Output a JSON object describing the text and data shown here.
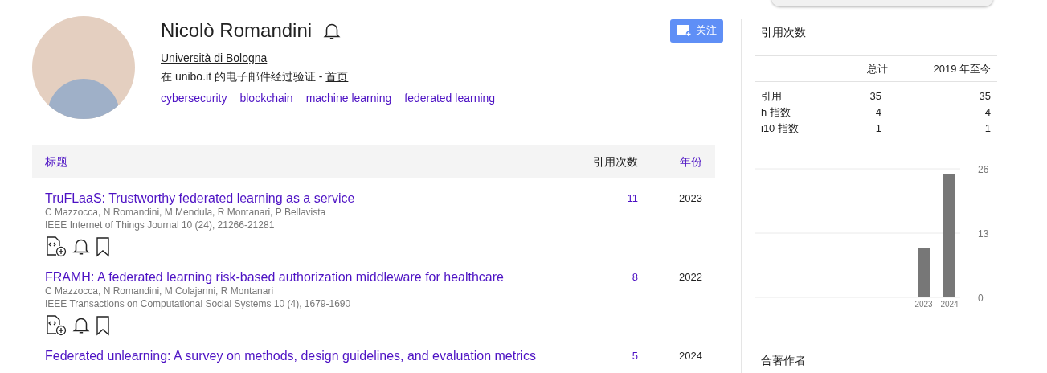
{
  "profile": {
    "name": "Nicolò Romandini",
    "affiliation": "Università di Bologna",
    "email_prefix": "在 unibo.it 的电子邮件经过验证 - ",
    "homepage": "首页",
    "interests": [
      "cybersecurity",
      "blockchain",
      "machine learning",
      "federated learning"
    ],
    "follow_button": "关注"
  },
  "articles": {
    "columns": [
      "标题",
      "引用次数",
      "年份"
    ],
    "rows": [
      {
        "title": "TruFLaaS: Trustworthy federated learning as a service",
        "authors": "C Mazzocca, N Romandini, M Mendula, R Montanari, P Bellavista",
        "venue": "IEEE Internet of Things Journal 10 (24), 21266-21281",
        "cited": "11",
        "year": "2023",
        "show_actions": true
      },
      {
        "title": "FRAMH: A federated learning risk-based authorization middleware for healthcare",
        "authors": "C Mazzocca, N Romandini, M Colajanni, R Montanari",
        "venue": "IEEE Transactions on Computational Social Systems 10 (4), 1679-1690",
        "cited": "8",
        "year": "2022",
        "show_actions": true
      },
      {
        "title": "Federated unlearning: A survey on methods, design guidelines, and evaluation metrics",
        "cited": "5",
        "year": "2024",
        "show_actions": false
      }
    ]
  },
  "citations": {
    "title": "引用次数",
    "columns": [
      "总计",
      "2019 年至今"
    ],
    "rows": [
      {
        "label": "引用",
        "total": "35",
        "since": "35"
      },
      {
        "label": "h 指数",
        "total": "4",
        "since": "4"
      },
      {
        "label": "i10 指数",
        "total": "1",
        "since": "1"
      }
    ],
    "chart_data": {
      "type": "bar",
      "categories": [
        "2023",
        "2024"
      ],
      "values": [
        10,
        25
      ],
      "ylim": [
        0,
        26
      ],
      "yticks": [
        0,
        13,
        26
      ]
    }
  },
  "coauthors": {
    "title": "合著作者"
  }
}
